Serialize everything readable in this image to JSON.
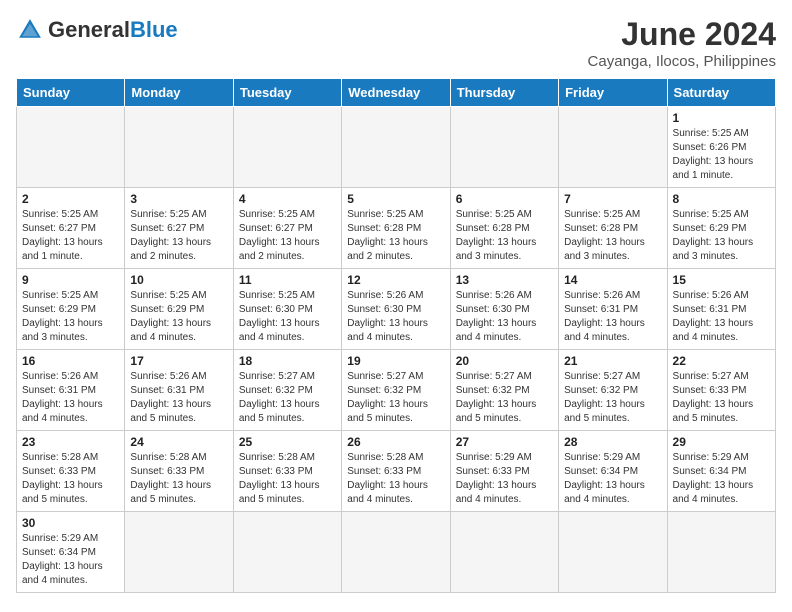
{
  "header": {
    "logo_general": "General",
    "logo_blue": "Blue",
    "month_year": "June 2024",
    "location": "Cayanga, Ilocos, Philippines"
  },
  "weekdays": [
    "Sunday",
    "Monday",
    "Tuesday",
    "Wednesday",
    "Thursday",
    "Friday",
    "Saturday"
  ],
  "weeks": [
    [
      {
        "day": "",
        "info": ""
      },
      {
        "day": "",
        "info": ""
      },
      {
        "day": "",
        "info": ""
      },
      {
        "day": "",
        "info": ""
      },
      {
        "day": "",
        "info": ""
      },
      {
        "day": "",
        "info": ""
      },
      {
        "day": "1",
        "info": "Sunrise: 5:25 AM\nSunset: 6:26 PM\nDaylight: 13 hours and 1 minute."
      }
    ],
    [
      {
        "day": "2",
        "info": "Sunrise: 5:25 AM\nSunset: 6:27 PM\nDaylight: 13 hours and 1 minute."
      },
      {
        "day": "3",
        "info": "Sunrise: 5:25 AM\nSunset: 6:27 PM\nDaylight: 13 hours and 2 minutes."
      },
      {
        "day": "4",
        "info": "Sunrise: 5:25 AM\nSunset: 6:27 PM\nDaylight: 13 hours and 2 minutes."
      },
      {
        "day": "5",
        "info": "Sunrise: 5:25 AM\nSunset: 6:28 PM\nDaylight: 13 hours and 2 minutes."
      },
      {
        "day": "6",
        "info": "Sunrise: 5:25 AM\nSunset: 6:28 PM\nDaylight: 13 hours and 3 minutes."
      },
      {
        "day": "7",
        "info": "Sunrise: 5:25 AM\nSunset: 6:28 PM\nDaylight: 13 hours and 3 minutes."
      },
      {
        "day": "8",
        "info": "Sunrise: 5:25 AM\nSunset: 6:29 PM\nDaylight: 13 hours and 3 minutes."
      }
    ],
    [
      {
        "day": "9",
        "info": "Sunrise: 5:25 AM\nSunset: 6:29 PM\nDaylight: 13 hours and 3 minutes."
      },
      {
        "day": "10",
        "info": "Sunrise: 5:25 AM\nSunset: 6:29 PM\nDaylight: 13 hours and 4 minutes."
      },
      {
        "day": "11",
        "info": "Sunrise: 5:25 AM\nSunset: 6:30 PM\nDaylight: 13 hours and 4 minutes."
      },
      {
        "day": "12",
        "info": "Sunrise: 5:26 AM\nSunset: 6:30 PM\nDaylight: 13 hours and 4 minutes."
      },
      {
        "day": "13",
        "info": "Sunrise: 5:26 AM\nSunset: 6:30 PM\nDaylight: 13 hours and 4 minutes."
      },
      {
        "day": "14",
        "info": "Sunrise: 5:26 AM\nSunset: 6:31 PM\nDaylight: 13 hours and 4 minutes."
      },
      {
        "day": "15",
        "info": "Sunrise: 5:26 AM\nSunset: 6:31 PM\nDaylight: 13 hours and 4 minutes."
      }
    ],
    [
      {
        "day": "16",
        "info": "Sunrise: 5:26 AM\nSunset: 6:31 PM\nDaylight: 13 hours and 4 minutes."
      },
      {
        "day": "17",
        "info": "Sunrise: 5:26 AM\nSunset: 6:31 PM\nDaylight: 13 hours and 5 minutes."
      },
      {
        "day": "18",
        "info": "Sunrise: 5:27 AM\nSunset: 6:32 PM\nDaylight: 13 hours and 5 minutes."
      },
      {
        "day": "19",
        "info": "Sunrise: 5:27 AM\nSunset: 6:32 PM\nDaylight: 13 hours and 5 minutes."
      },
      {
        "day": "20",
        "info": "Sunrise: 5:27 AM\nSunset: 6:32 PM\nDaylight: 13 hours and 5 minutes."
      },
      {
        "day": "21",
        "info": "Sunrise: 5:27 AM\nSunset: 6:32 PM\nDaylight: 13 hours and 5 minutes."
      },
      {
        "day": "22",
        "info": "Sunrise: 5:27 AM\nSunset: 6:33 PM\nDaylight: 13 hours and 5 minutes."
      }
    ],
    [
      {
        "day": "23",
        "info": "Sunrise: 5:28 AM\nSunset: 6:33 PM\nDaylight: 13 hours and 5 minutes."
      },
      {
        "day": "24",
        "info": "Sunrise: 5:28 AM\nSunset: 6:33 PM\nDaylight: 13 hours and 5 minutes."
      },
      {
        "day": "25",
        "info": "Sunrise: 5:28 AM\nSunset: 6:33 PM\nDaylight: 13 hours and 5 minutes."
      },
      {
        "day": "26",
        "info": "Sunrise: 5:28 AM\nSunset: 6:33 PM\nDaylight: 13 hours and 4 minutes."
      },
      {
        "day": "27",
        "info": "Sunrise: 5:29 AM\nSunset: 6:33 PM\nDaylight: 13 hours and 4 minutes."
      },
      {
        "day": "28",
        "info": "Sunrise: 5:29 AM\nSunset: 6:34 PM\nDaylight: 13 hours and 4 minutes."
      },
      {
        "day": "29",
        "info": "Sunrise: 5:29 AM\nSunset: 6:34 PM\nDaylight: 13 hours and 4 minutes."
      }
    ],
    [
      {
        "day": "30",
        "info": "Sunrise: 5:29 AM\nSunset: 6:34 PM\nDaylight: 13 hours and 4 minutes."
      },
      {
        "day": "",
        "info": ""
      },
      {
        "day": "",
        "info": ""
      },
      {
        "day": "",
        "info": ""
      },
      {
        "day": "",
        "info": ""
      },
      {
        "day": "",
        "info": ""
      },
      {
        "day": "",
        "info": ""
      }
    ]
  ],
  "colors": {
    "header_bg": "#1a7abf",
    "logo_blue": "#1a7abf",
    "empty_cell": "#f5f5f5"
  }
}
